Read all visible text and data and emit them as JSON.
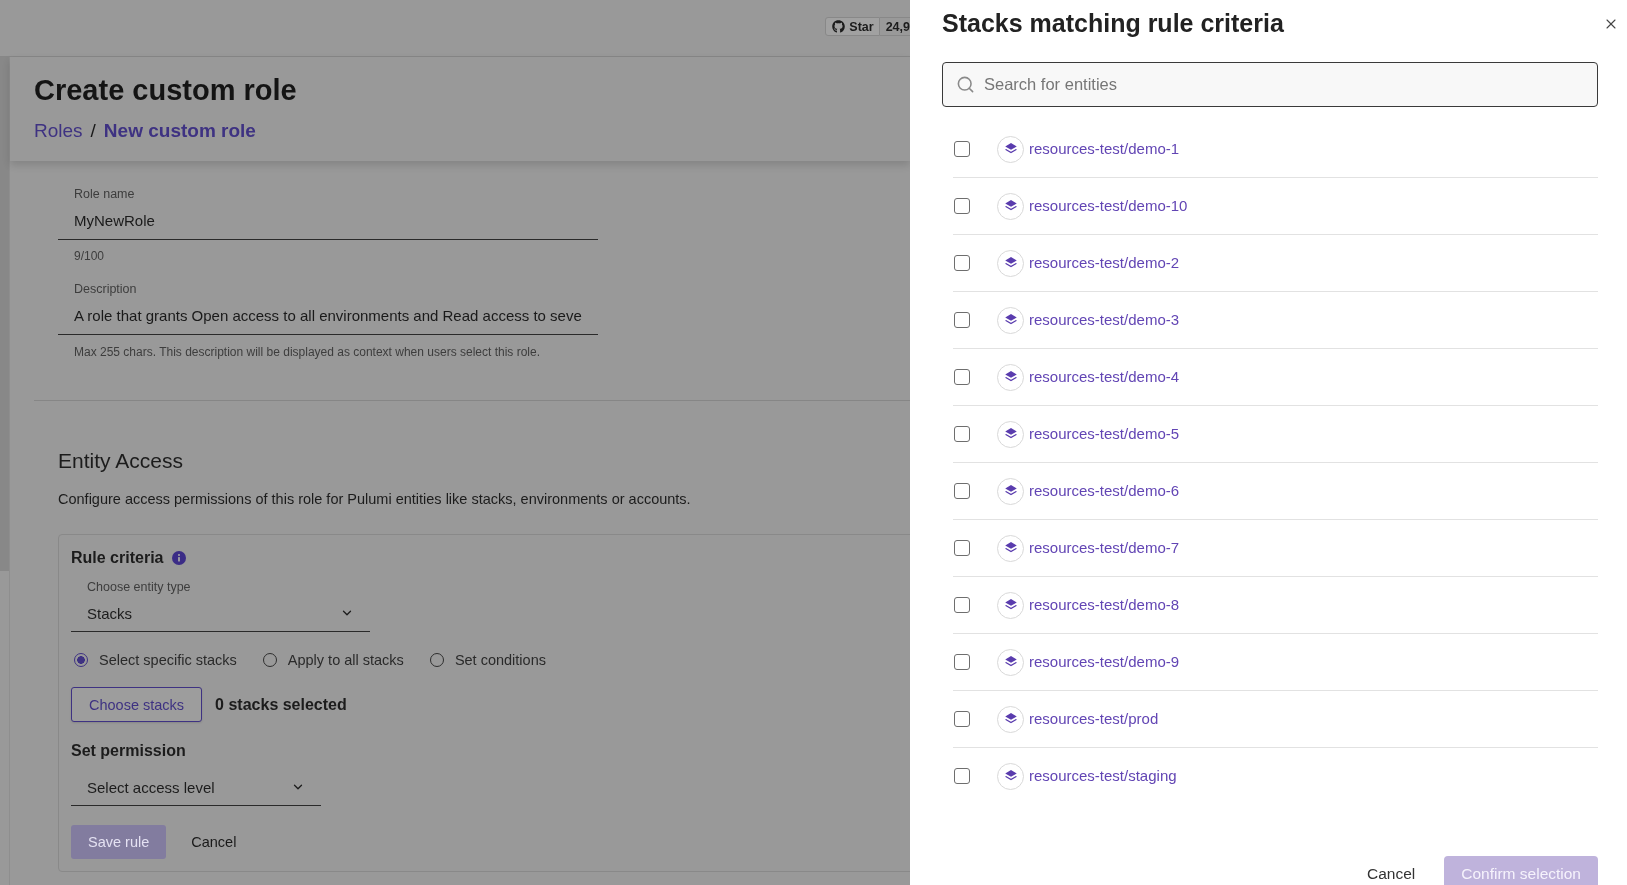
{
  "top_bar": {
    "star_button": {
      "label": "Star"
    },
    "star_count": "24,9"
  },
  "page": {
    "title": "Create custom role",
    "breadcrumb": {
      "separator": "/",
      "items": [
        {
          "label": "Roles",
          "current": false
        },
        {
          "label": "New custom role",
          "current": true
        }
      ]
    },
    "name_and_description": {
      "role_name": {
        "label": "Role name",
        "value": "MyNewRole",
        "counter": "9/100"
      },
      "description": {
        "label": "Description",
        "value": "A role that grants Open access to all environments and Read access to seve",
        "helper": "Max 255 chars. This description will be displayed as context when users select this role."
      }
    },
    "entity_access": {
      "heading": "Entity Access",
      "description": "Configure access permissions of this role for Pulumi entities like stacks, environments or accounts.",
      "rule": {
        "title": "Rule criteria",
        "entity_type": {
          "label": "Choose entity type",
          "value": "Stacks"
        },
        "scope_options": [
          {
            "label": "Select specific stacks",
            "selected": true
          },
          {
            "label": "Apply to all stacks",
            "selected": false
          },
          {
            "label": "Set conditions",
            "selected": false
          }
        ],
        "choose_button": "Choose stacks",
        "selection_count": "0 stacks selected",
        "permission": {
          "heading": "Set permission",
          "placeholder": "Select access level"
        },
        "buttons": [
          {
            "label": "Save rule",
            "kind": "primary",
            "disabled": true
          },
          {
            "label": "Cancel",
            "kind": "text",
            "disabled": false
          }
        ]
      }
    }
  },
  "drawer": {
    "title": "Stacks matching rule criteria",
    "search": {
      "placeholder": "Search for entities"
    },
    "stacks": [
      {
        "name": "resources-test/demo-1",
        "checked": false
      },
      {
        "name": "resources-test/demo-10",
        "checked": false
      },
      {
        "name": "resources-test/demo-2",
        "checked": false
      },
      {
        "name": "resources-test/demo-3",
        "checked": false
      },
      {
        "name": "resources-test/demo-4",
        "checked": false
      },
      {
        "name": "resources-test/demo-5",
        "checked": false
      },
      {
        "name": "resources-test/demo-6",
        "checked": false
      },
      {
        "name": "resources-test/demo-7",
        "checked": false
      },
      {
        "name": "resources-test/demo-8",
        "checked": false
      },
      {
        "name": "resources-test/demo-9",
        "checked": false
      },
      {
        "name": "resources-test/prod",
        "checked": false
      },
      {
        "name": "resources-test/staging",
        "checked": false
      }
    ],
    "buttons": [
      {
        "label": "Cancel",
        "kind": "text",
        "disabled": false
      },
      {
        "label": "Confirm selection",
        "kind": "primary",
        "disabled": true
      }
    ]
  }
}
